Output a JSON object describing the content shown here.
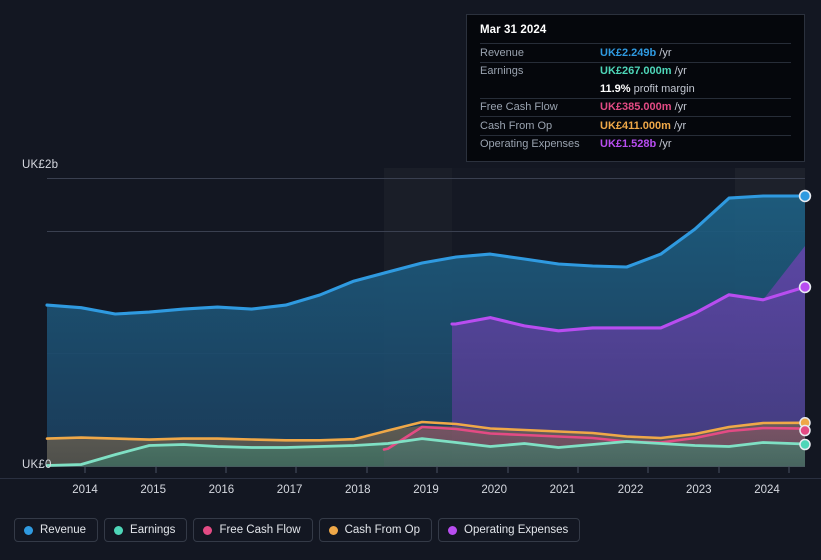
{
  "background": "#131722",
  "axes": {
    "y_top_label": "UK£2b",
    "y_bottom_label": "UK£0",
    "x_ticks": [
      "2014",
      "2015",
      "2016",
      "2017",
      "2018",
      "2019",
      "2020",
      "2021",
      "2022",
      "2023",
      "2024"
    ]
  },
  "tooltip": {
    "date": "Mar 31 2024",
    "rows": [
      {
        "key": "Revenue",
        "value": "UK£2.249b",
        "suffix": "/yr",
        "color": "#2f9ae0"
      },
      {
        "key": "Earnings",
        "value": "UK£267.000m",
        "suffix": "/yr",
        "color": "#4ed6b8"
      },
      {
        "key": "",
        "value": "11.9%",
        "suffix": "profit margin",
        "color": "#ffffff"
      },
      {
        "key": "Free Cash Flow",
        "value": "UK£385.000m",
        "suffix": "/yr",
        "color": "#e34b84"
      },
      {
        "key": "Cash From Op",
        "value": "UK£411.000m",
        "suffix": "/yr",
        "color": "#efa848"
      },
      {
        "key": "Operating Expenses",
        "value": "UK£1.528b",
        "suffix": "/yr",
        "color": "#b84df0"
      }
    ]
  },
  "legend": [
    {
      "label": "Revenue",
      "color": "#2f9ae0"
    },
    {
      "label": "Earnings",
      "color": "#4ed6b8"
    },
    {
      "label": "Free Cash Flow",
      "color": "#e34b84"
    },
    {
      "label": "Cash From Op",
      "color": "#efa848"
    },
    {
      "label": "Operating Expenses",
      "color": "#b84df0"
    }
  ],
  "chart_data": {
    "type": "area",
    "title": "",
    "xlabel": "",
    "ylabel": "UK£",
    "currency": "UK£",
    "ylim": [
      0,
      2.0
    ],
    "y_gridlines": [
      0,
      0.78,
      1.63,
      2.0
    ],
    "grid": true,
    "legend_position": "bottom-left",
    "x": [
      2013.5,
      2014,
      2014.5,
      2015,
      2015.5,
      2016,
      2016.5,
      2017,
      2017.5,
      2018,
      2018.5,
      2019,
      2019.5,
      2020,
      2020.5,
      2021,
      2021.5,
      2022,
      2022.5,
      2023,
      2023.5,
      2024
    ],
    "x_tick_years": [
      2014,
      2015,
      2016,
      2017,
      2018,
      2019,
      2020,
      2021,
      2022,
      2023,
      2024
    ],
    "series": [
      {
        "name": "Revenue",
        "color": "#2f9ae0",
        "unit": "b",
        "values": [
          1.118,
          1.1,
          1.056,
          1.069,
          1.09,
          1.104,
          1.09,
          1.118,
          1.188,
          1.285,
          1.348,
          1.41,
          1.452,
          1.472,
          1.438,
          1.403,
          1.389,
          1.382,
          1.472,
          1.646,
          1.861,
          2.249
        ]
      },
      {
        "name": "Operating Expenses",
        "color": "#b84df0",
        "unit": "b",
        "start_x": 2019,
        "values": [
          null,
          null,
          null,
          null,
          null,
          null,
          null,
          null,
          null,
          null,
          null,
          0.986,
          1.03,
          0.972,
          0.938,
          0.958,
          0.958,
          0.958,
          1.06,
          1.188,
          1.153,
          1.528
        ]
      },
      {
        "name": "Cash From Op",
        "color": "#efa848",
        "unit": "m",
        "values": [
          0.194,
          0.201,
          0.194,
          0.187,
          0.194,
          0.194,
          0.188,
          0.182,
          0.182,
          0.19,
          0.25,
          0.285,
          0.278,
          0.25,
          0.243,
          0.236,
          0.229,
          0.208,
          0.201,
          0.229,
          0.278,
          0.411
        ]
      },
      {
        "name": "Free Cash Flow",
        "color": "#e34b84",
        "unit": "m",
        "start_x": 2018,
        "values": [
          null,
          null,
          null,
          null,
          null,
          null,
          null,
          null,
          null,
          0.118,
          0.208,
          0.257,
          0.25,
          0.222,
          0.215,
          0.208,
          0.201,
          0.18,
          0.174,
          0.201,
          0.25,
          0.385
        ]
      },
      {
        "name": "Earnings",
        "color": "#4ed6b8",
        "unit": "m",
        "values": [
          0.007,
          0.014,
          0.083,
          0.146,
          0.153,
          0.139,
          0.132,
          0.132,
          0.139,
          0.146,
          0.16,
          0.194,
          0.167,
          0.139,
          0.16,
          0.132,
          0.153,
          0.174,
          0.16,
          0.146,
          0.167,
          0.267
        ]
      }
    ],
    "band_markers_x": [
      2018,
      2019,
      2023.2
    ]
  }
}
